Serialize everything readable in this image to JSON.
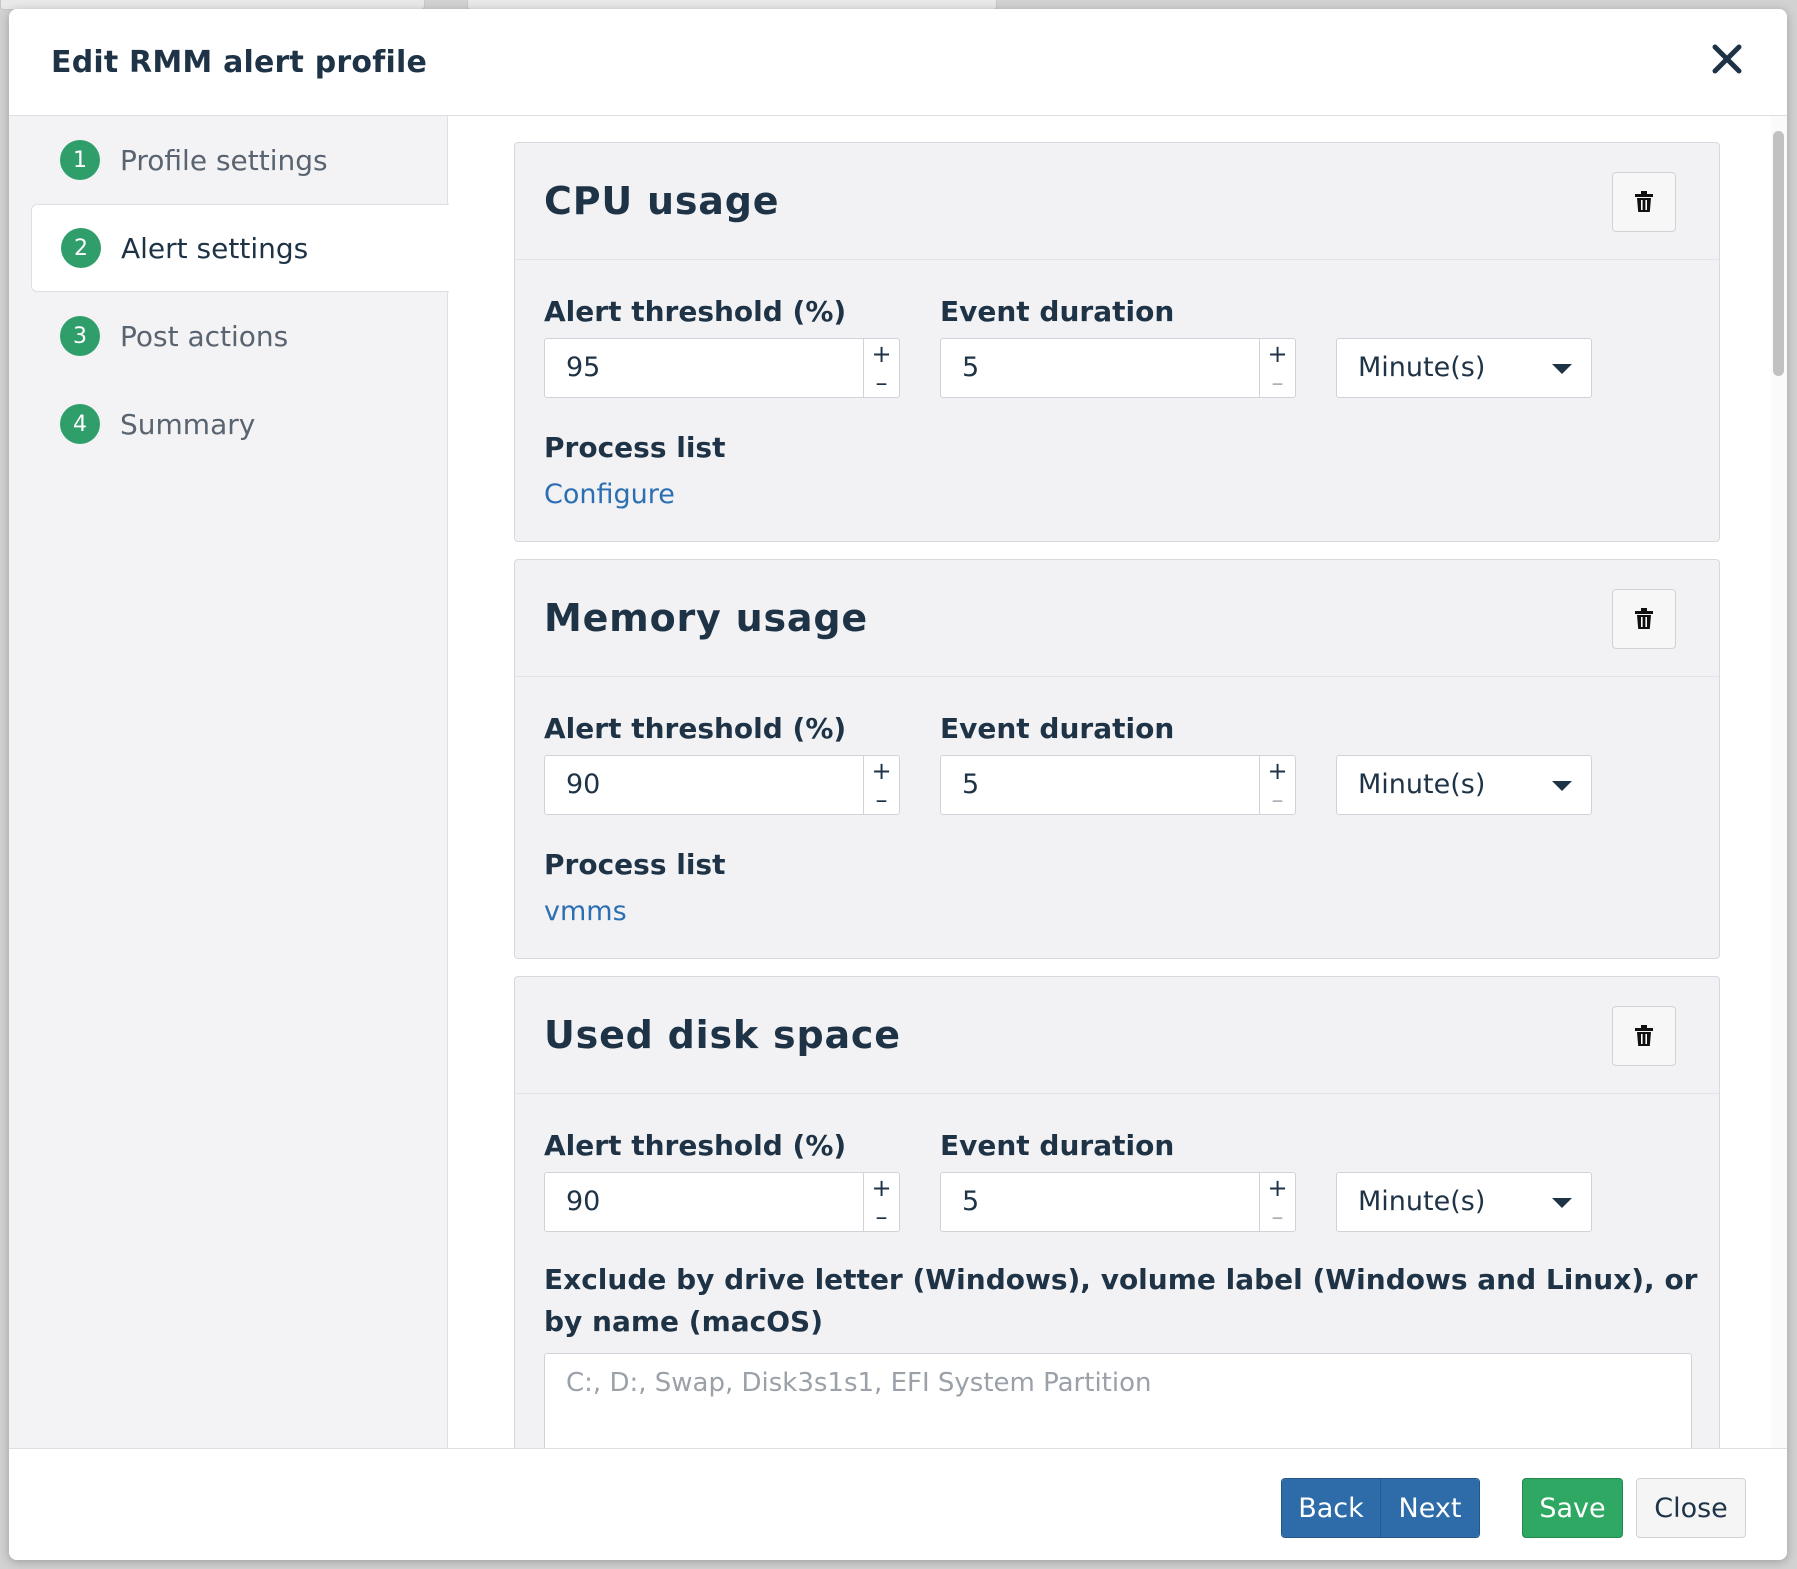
{
  "modal": {
    "title": "Edit RMM alert profile"
  },
  "steps": [
    {
      "num": "1",
      "label": "Profile settings"
    },
    {
      "num": "2",
      "label": "Alert settings"
    },
    {
      "num": "3",
      "label": "Post actions"
    },
    {
      "num": "4",
      "label": "Summary"
    }
  ],
  "active_step": "Alert settings",
  "cards": [
    {
      "title": "CPU usage",
      "threshold_label": "Alert threshold (%)",
      "threshold_value": "95",
      "duration_label": "Event duration",
      "duration_value": "5",
      "unit_value": "Minute(s)",
      "process_label": "Process list",
      "process_link": "Configure"
    },
    {
      "title": "Memory usage",
      "threshold_label": "Alert threshold (%)",
      "threshold_value": "90",
      "duration_label": "Event duration",
      "duration_value": "5",
      "unit_value": "Minute(s)",
      "process_label": "Process list",
      "process_link": "vmms"
    },
    {
      "title": "Used disk space",
      "threshold_label": "Alert threshold (%)",
      "threshold_value": "90",
      "duration_label": "Event duration",
      "duration_value": "5",
      "unit_value": "Minute(s)",
      "exclude_label": "Exclude by drive letter (Windows), volume label (Windows and Linux), or by name (macOS)",
      "exclude_placeholder": "C:, D:, Swap, Disk3s1s1, EFI System Partition"
    }
  ],
  "spinner": {
    "plus": "+",
    "minus": "–"
  },
  "footer": {
    "back": "Back",
    "next": "Next",
    "save": "Save",
    "close": "Close"
  },
  "colors": {
    "accent_green": "#2f9e6b",
    "primary_blue": "#2d6ca8",
    "save_green": "#2ea862",
    "link_blue": "#2b6fb2",
    "text_dark": "#1f3347"
  },
  "icons": {
    "close": "close-icon",
    "delete": "trash-icon",
    "dropdown": "caret-down-icon"
  }
}
